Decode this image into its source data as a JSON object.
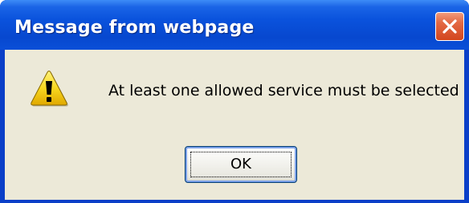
{
  "dialog": {
    "title": "Message from webpage",
    "message": "At least one allowed service must be selected",
    "ok_label": "OK",
    "icon": "warning-icon",
    "close_icon": "close-icon"
  },
  "colors": {
    "titlebar": "#0a52dc",
    "client_background": "#ece9d8",
    "close_button": "#d2461e",
    "warning_yellow": "#f8d820"
  }
}
